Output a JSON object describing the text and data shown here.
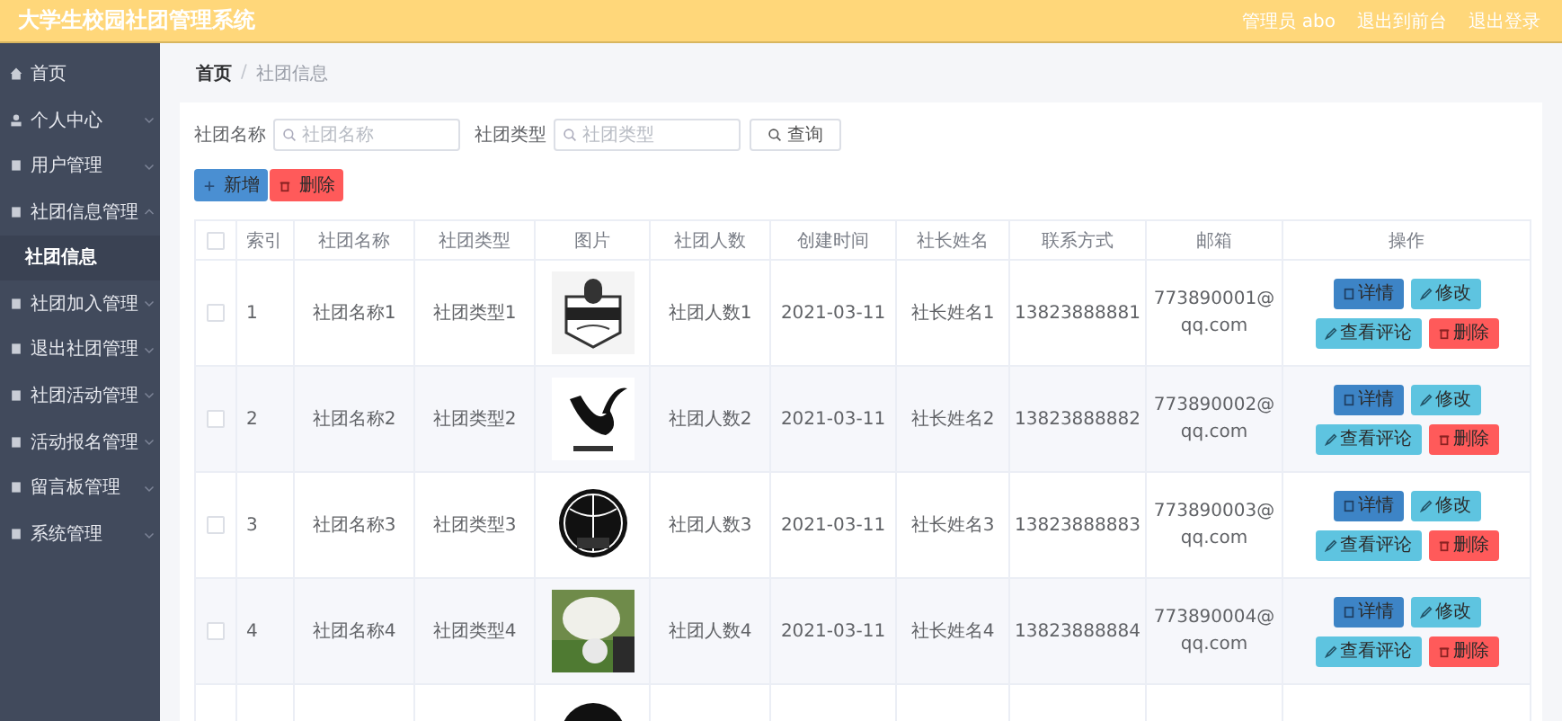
{
  "header": {
    "title": "大学生校园社团管理系统",
    "links": [
      "管理员 abo",
      "退出到前台",
      "退出登录"
    ]
  },
  "sidebar": {
    "items": [
      {
        "label": "首页"
      },
      {
        "label": "个人中心",
        "expanded": false
      },
      {
        "label": "用户管理",
        "expanded": false
      },
      {
        "label": "社团信息管理",
        "expanded": true,
        "children": [
          {
            "label": "社团信息",
            "selected": true
          }
        ]
      },
      {
        "label": "社团加入管理",
        "expanded": false
      },
      {
        "label": "退出社团管理",
        "expanded": false
      },
      {
        "label": "社团活动管理",
        "expanded": false
      },
      {
        "label": "活动报名管理",
        "expanded": false
      },
      {
        "label": "留言板管理",
        "expanded": false
      },
      {
        "label": "系统管理",
        "expanded": false
      }
    ]
  },
  "breadcrumb": {
    "items": [
      "首页",
      "社团信息"
    ],
    "separator": "/"
  },
  "search": {
    "fields": [
      {
        "label": "社团名称",
        "placeholder": "社团名称"
      },
      {
        "label": "社团类型",
        "placeholder": "社团类型"
      }
    ],
    "button": "查询"
  },
  "actions": [
    {
      "label": "新增",
      "kind": "add"
    },
    {
      "label": "删除",
      "kind": "delete"
    }
  ],
  "table": {
    "header_checked": false,
    "columns": [
      "索引",
      "社团名称",
      "社团类型",
      "图片",
      "社团人数",
      "创建时间",
      "社长姓名",
      "联系方式",
      "邮箱",
      "操作"
    ],
    "rows": [
      {
        "checked": false,
        "index": "1",
        "image": {
          "kind": "picture"
        },
        "cells": [
          "社团名称1",
          "社团类型1",
          "社团人数1",
          "2021-03-11",
          "社长姓名1",
          "13823888881",
          "773890001@qq.com"
        ],
        "buttons": [
          {
            "label": "详情",
            "kind": "detail"
          },
          {
            "label": "修改",
            "kind": "edit"
          },
          {
            "label": "查看评论",
            "kind": "comments"
          },
          {
            "label": "删除",
            "kind": "delete"
          }
        ]
      },
      {
        "checked": false,
        "index": "2",
        "image": {
          "kind": "picture"
        },
        "cells": [
          "社团名称2",
          "社团类型2",
          "社团人数2",
          "2021-03-11",
          "社长姓名2",
          "13823888882",
          "773890002@qq.com"
        ],
        "buttons": [
          {
            "label": "详情",
            "kind": "detail"
          },
          {
            "label": "修改",
            "kind": "edit"
          },
          {
            "label": "查看评论",
            "kind": "comments"
          },
          {
            "label": "删除",
            "kind": "delete"
          }
        ]
      },
      {
        "checked": false,
        "index": "3",
        "image": {
          "kind": "picture"
        },
        "cells": [
          "社团名称3",
          "社团类型3",
          "社团人数3",
          "2021-03-11",
          "社长姓名3",
          "13823888883",
          "773890003@qq.com"
        ],
        "buttons": [
          {
            "label": "详情",
            "kind": "detail"
          },
          {
            "label": "修改",
            "kind": "edit"
          },
          {
            "label": "查看评论",
            "kind": "comments"
          },
          {
            "label": "删除",
            "kind": "delete"
          }
        ]
      },
      {
        "checked": false,
        "index": "4",
        "image": {
          "kind": "picture"
        },
        "cells": [
          "社团名称4",
          "社团类型4",
          "社团人数4",
          "2021-03-11",
          "社长姓名4",
          "13823888884",
          "773890004@qq.com"
        ],
        "buttons": [
          {
            "label": "详情",
            "kind": "detail"
          },
          {
            "label": "修改",
            "kind": "edit"
          },
          {
            "label": "查看评论",
            "kind": "comments"
          },
          {
            "label": "删除",
            "kind": "delete"
          }
        ]
      },
      {
        "image": {
          "kind": "picture"
        }
      }
    ]
  }
}
